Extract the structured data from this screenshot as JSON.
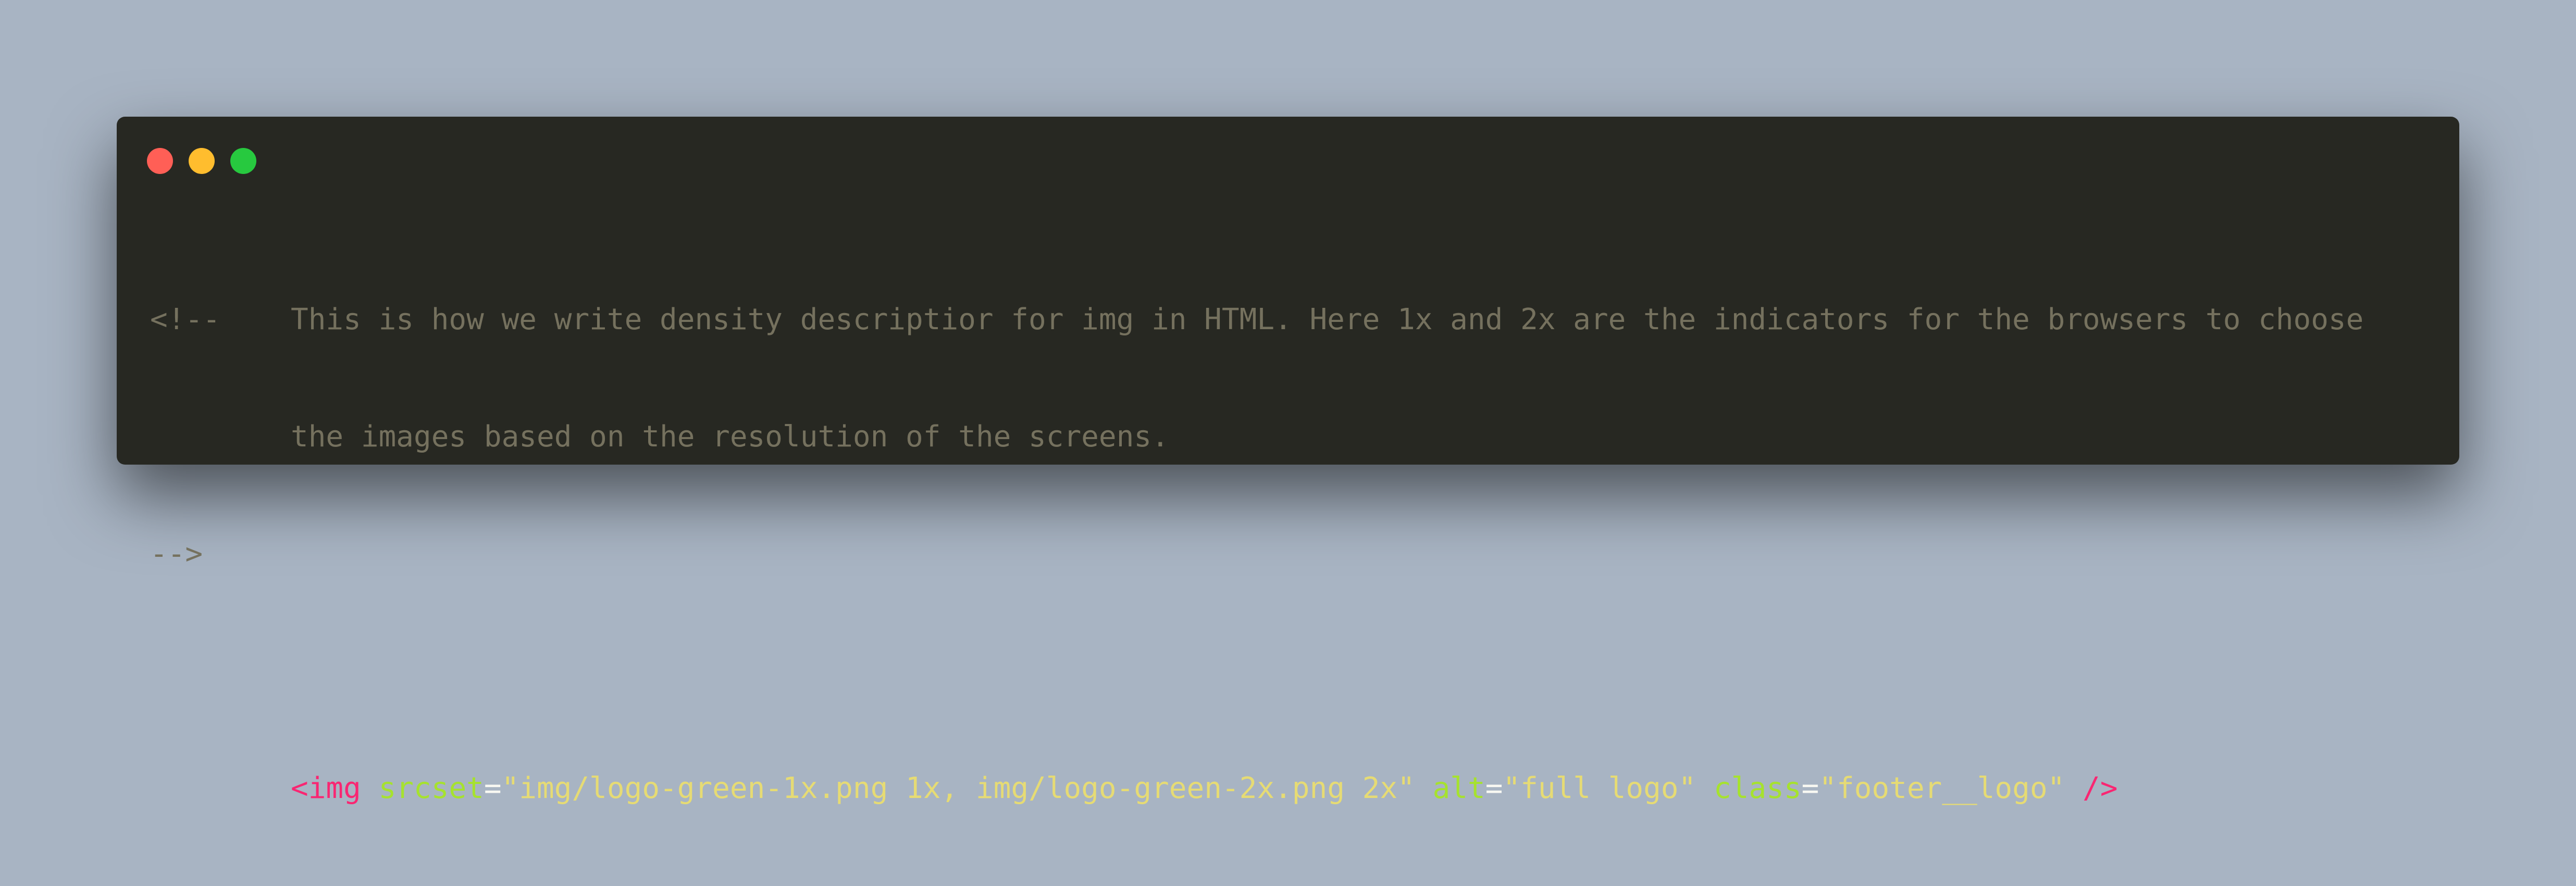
{
  "window": {
    "controls": {
      "close_color": "#ff5f56",
      "minimize_color": "#ffbd2e",
      "maximize_color": "#27c93f"
    }
  },
  "code": {
    "comment_open": "<!--",
    "comment_line1": "This is how we write density descriptior for img in HTML. Here 1x and 2x are the indicators for the browsers to choose",
    "comment_line2": "the images based on the resolution of the screens.",
    "comment_close": "-->",
    "img_tag_open": "<img",
    "attr1_name": "srcset",
    "attr1_value": "\"img/logo-green-1x.png 1x, img/logo-green-2x.png 2x\"",
    "attr2_name": "alt",
    "attr2_value": "\"full logo\"",
    "attr3_name": "class",
    "attr3_value": "\"footer__logo\"",
    "eq": "=",
    "img_tag_close": "/>"
  }
}
